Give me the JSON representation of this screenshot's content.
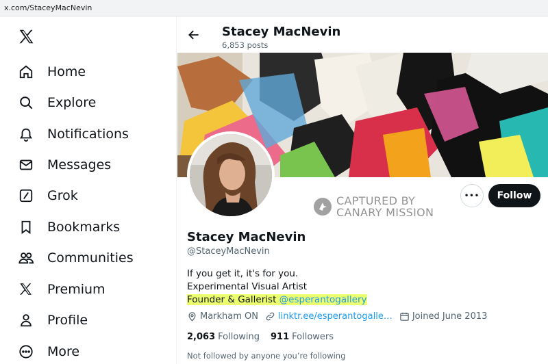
{
  "browser": {
    "url": "x.com/StaceyMacNevin"
  },
  "sidebar": {
    "logo": "x-logo",
    "items": [
      {
        "label": "Home",
        "icon": "home-icon"
      },
      {
        "label": "Explore",
        "icon": "search-icon"
      },
      {
        "label": "Notifications",
        "icon": "bell-icon"
      },
      {
        "label": "Messages",
        "icon": "envelope-icon"
      },
      {
        "label": "Grok",
        "icon": "grok-icon"
      },
      {
        "label": "Bookmarks",
        "icon": "bookmark-icon"
      },
      {
        "label": "Communities",
        "icon": "people-icon"
      },
      {
        "label": "Premium",
        "icon": "x-logo-icon"
      },
      {
        "label": "Profile",
        "icon": "person-icon"
      },
      {
        "label": "More",
        "icon": "more-circle-icon"
      }
    ]
  },
  "header": {
    "name": "Stacey MacNevin",
    "posts": "6,853 posts"
  },
  "profile": {
    "name": "Stacey MacNevin",
    "handle": "@StaceyMacNevin",
    "bio": {
      "line1": "If you get it, it's for you.",
      "line2": "Experimental Visual Artist",
      "line3_text": "Founder & Gallerist ",
      "line3_mention": "@esperantogallery"
    },
    "location": "Markham ON",
    "link": "linktr.ee/esperantogalle…",
    "joined": "Joined June 2013",
    "following_count": "2,063",
    "following_label": "Following",
    "followers_count": "911",
    "followers_label": "Followers",
    "not_followed": "Not followed by anyone you’re following"
  },
  "actions": {
    "more": "•••",
    "follow": "Follow"
  },
  "watermark": {
    "line1": "CAPTURED BY",
    "line2": "CANARY MISSION"
  },
  "colors": {
    "accent": "#1d9bf0",
    "highlight": "#ecff6f",
    "text": "#0f1419",
    "muted": "#536471"
  }
}
